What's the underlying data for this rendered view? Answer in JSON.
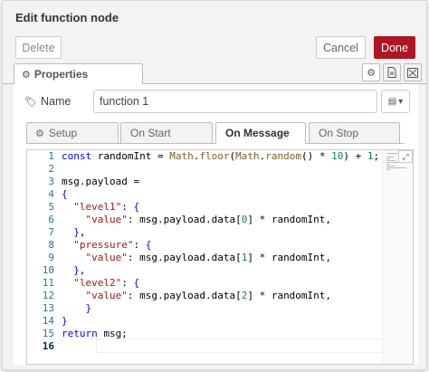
{
  "dialog": {
    "title": "Edit function node",
    "delete_label": "Delete",
    "cancel_label": "Cancel",
    "done_label": "Done",
    "accent_color": "#ad1625"
  },
  "tabs": {
    "properties_label": "Properties",
    "properties_icon": "gear-icon",
    "side_icons": [
      "gear-icon",
      "description-icon",
      "appearance-icon"
    ]
  },
  "name_field": {
    "label": "Name",
    "value": "function 1",
    "icon": "tag-icon"
  },
  "subtabs": [
    {
      "label": "Setup",
      "active": false
    },
    {
      "label": "On Start",
      "active": false
    },
    {
      "label": "On Message",
      "active": true
    },
    {
      "label": "On Stop",
      "active": false
    }
  ],
  "code": {
    "lines": [
      "1",
      "2",
      "3",
      "4",
      "5",
      "6",
      "7",
      "8",
      "9",
      "10",
      "11",
      "12",
      "13",
      "14",
      "15",
      "16"
    ],
    "current_line": "16"
  }
}
